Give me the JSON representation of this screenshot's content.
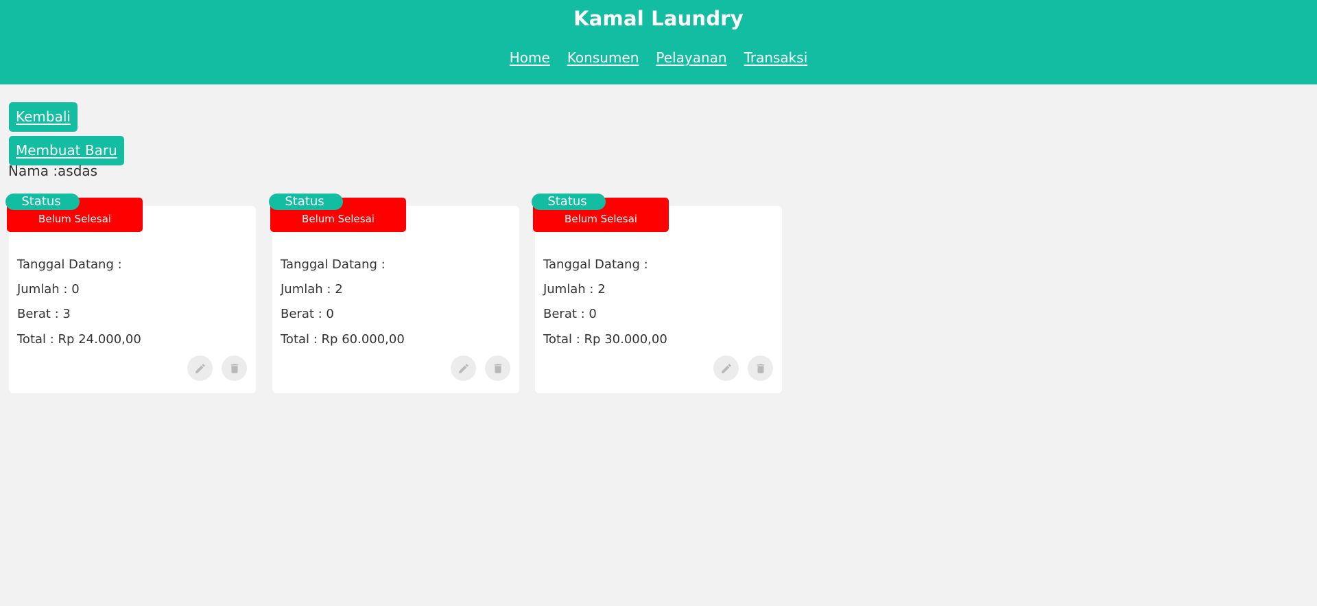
{
  "header": {
    "title": "Kamal Laundry",
    "nav": [
      "Home",
      "Konsumen",
      "Pelayanan",
      "Transaksi"
    ]
  },
  "actions": {
    "back_label": "Kembali",
    "new_label": "Membuat Baru"
  },
  "customer": {
    "label": "Nama :asdas"
  },
  "cards": [
    {
      "status_label": "Status",
      "status_value": "Belum Selesai",
      "tanggal": "Tanggal Datang :",
      "jumlah": "Jumlah : 0",
      "berat": "Berat : 3",
      "total": "Total : Rp 24.000,00"
    },
    {
      "status_label": "Status",
      "status_value": "Belum Selesai",
      "tanggal": "Tanggal Datang :",
      "jumlah": "Jumlah : 2",
      "berat": "Berat : 0",
      "total": "Total : Rp 60.000,00"
    },
    {
      "status_label": "Status",
      "status_value": "Belum Selesai",
      "tanggal": "Tanggal Datang :",
      "jumlah": "Jumlah : 2",
      "berat": "Berat : 0",
      "total": "Total : Rp 30.000,00"
    }
  ],
  "icons": {
    "edit": "pencil-icon",
    "delete": "trash-icon"
  },
  "colors": {
    "accent": "#13bda2",
    "status_pending": "#ff0000",
    "background": "#f2f2f2"
  }
}
